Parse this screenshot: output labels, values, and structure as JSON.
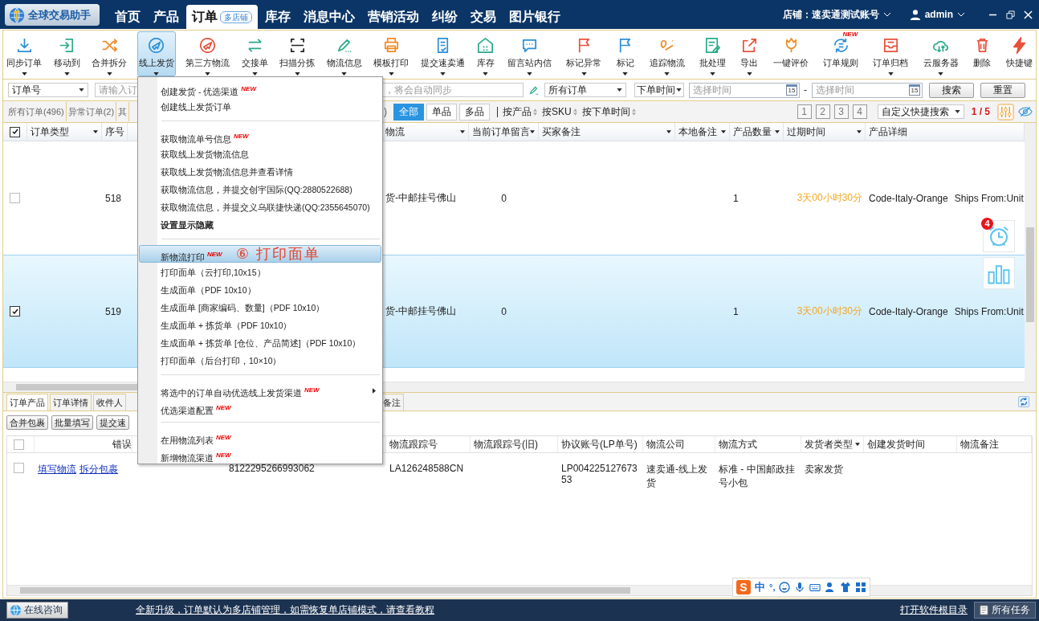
{
  "topbar": {
    "logo": "全球交易助手",
    "nav": [
      {
        "label": "首页",
        "selected": false
      },
      {
        "label": "产品",
        "selected": false
      },
      {
        "label": "订单",
        "selected": true,
        "badge": "多店铺"
      },
      {
        "label": "库存",
        "selected": false
      },
      {
        "label": "消息中心",
        "selected": false
      },
      {
        "label": "营销活动",
        "selected": false
      },
      {
        "label": "纠纷",
        "selected": false
      },
      {
        "label": "交易",
        "selected": false
      },
      {
        "label": "图片银行",
        "selected": false
      }
    ],
    "store": "店铺：速卖通测试账号",
    "user": "admin"
  },
  "toolbar": {
    "left": [
      {
        "label": "同步订单",
        "dropdown": true,
        "selected": false
      },
      {
        "label": "移动到",
        "dropdown": true,
        "selected": false
      },
      {
        "label": "合并拆分",
        "dropdown": true,
        "selected": false
      },
      {
        "label": "线上发货",
        "dropdown": true,
        "selected": true
      },
      {
        "label": "第三方物流",
        "dropdown": true,
        "selected": false
      },
      {
        "label": "交接单",
        "dropdown": true,
        "selected": false
      },
      {
        "label": "扫描分拣",
        "dropdown": true,
        "selected": false
      },
      {
        "label": "物流信息",
        "dropdown": true,
        "selected": false
      },
      {
        "label": "模板打印",
        "dropdown": true,
        "selected": false
      },
      {
        "label": "提交速卖通",
        "dropdown": true,
        "selected": false
      },
      {
        "label": "库存",
        "dropdown": true,
        "selected": false
      }
    ],
    "right": [
      {
        "label": "留言站内信",
        "dropdown": true,
        "selected": false
      },
      {
        "label": "标记异常",
        "dropdown": true,
        "selected": false
      },
      {
        "label": "标记",
        "dropdown": true,
        "selected": false
      },
      {
        "label": "追踪物流",
        "dropdown": true,
        "selected": false
      },
      {
        "label": "批处理",
        "dropdown": true,
        "selected": false
      },
      {
        "label": "导出",
        "dropdown": true,
        "selected": false
      },
      {
        "label": "一键评价",
        "dropdown": false,
        "selected": false
      },
      {
        "label": "订单规则",
        "dropdown": false,
        "selected": false,
        "badge": "NEW"
      },
      {
        "label": "订单归档",
        "dropdown": true,
        "selected": false
      },
      {
        "label": "云服务器",
        "dropdown": true,
        "selected": false
      },
      {
        "label": "删除",
        "dropdown": false,
        "selected": false
      },
      {
        "label": "快捷键",
        "dropdown": false,
        "selected": false
      }
    ]
  },
  "filters": {
    "field_select": "订单号",
    "search_placeholder_start": "请输入订",
    "search_placeholder_end": "，将会自动同步",
    "status_select": "所有订单",
    "time_select": "下单时间",
    "date_from": "选择时间",
    "date_to": "选择时间",
    "calendar_from_day": "15",
    "calendar_to_day": "15",
    "range_separator": "-",
    "buttons": [
      "搜索",
      "重置"
    ]
  },
  "status_tabs": {
    "tabs": [
      {
        "label": "所有订单(496)",
        "selected": false
      },
      {
        "label": "异常订单(2)",
        "selected": false
      },
      {
        "label": "其",
        "selected": false
      }
    ],
    "hidden_tab_tail": ")",
    "chips": [
      {
        "label": "全部",
        "selected": true
      },
      {
        "label": "单品",
        "selected": false
      },
      {
        "label": "多品",
        "selected": false
      }
    ],
    "sorts": [
      "按产品",
      "按SKU",
      "按下单时间"
    ],
    "pages": [
      "1",
      "2",
      "3",
      "4"
    ],
    "quick_search": "自定义快捷搜索",
    "page_info": "1 / 5"
  },
  "table": {
    "all_checked": true,
    "columns_left": [
      {
        "label": "订单类型",
        "dropdown": true
      },
      {
        "label": "序号",
        "dropdown": false
      }
    ],
    "columns_right": [
      {
        "label": "物流",
        "dropdown": true
      },
      {
        "label": "当前订单留言",
        "dropdown": true
      },
      {
        "label": "买家备注",
        "dropdown": true
      },
      {
        "label": "本地备注",
        "dropdown": true
      },
      {
        "label": "产品数量",
        "dropdown": true
      },
      {
        "label": "过期时间",
        "dropdown": true
      },
      {
        "label": "产品详细",
        "dropdown": false
      }
    ],
    "rows": [
      {
        "checked": false,
        "selected": false,
        "no": "518",
        "logistics": "货-中邮挂号佛山",
        "message": "0",
        "quantity": "1",
        "expires": "3天00小时30分",
        "product": "Code-Italy-Orange",
        "ships_from": "Ships From:Unit"
      },
      {
        "checked": true,
        "selected": true,
        "no": "519",
        "logistics": "货-中邮挂号佛山",
        "message": "0",
        "quantity": "1",
        "expires": "3天00小时30分",
        "product": "Code-Italy-Orange",
        "ships_from": "Ships From:Unit"
      }
    ]
  },
  "reminder": {
    "badge": "4"
  },
  "detail_panel": {
    "tabs": [
      {
        "label": "订单产品",
        "selected": true
      },
      {
        "label": "订单详情",
        "selected": false
      },
      {
        "label": "收件人",
        "selected": false
      }
    ],
    "hidden_tab_tail": "备注",
    "buttons": [
      "合并包裹",
      "批量填写",
      "提交速"
    ],
    "column_left": "错误",
    "all_checked": false,
    "columns": [
      {
        "label": "物流跟踪号",
        "dropdown": false
      },
      {
        "label": "物流跟踪号(旧)",
        "dropdown": false
      },
      {
        "label": "协议账号(LP单号)",
        "dropdown": false
      },
      {
        "label": "物流公司",
        "dropdown": false
      },
      {
        "label": "物流方式",
        "dropdown": false
      },
      {
        "label": "发货者类型",
        "dropdown": true
      },
      {
        "label": "创建发货时间",
        "dropdown": false
      },
      {
        "label": "物流备注",
        "dropdown": false
      }
    ],
    "rows": [
      {
        "checked": false,
        "links": [
          "填写物流",
          "拆分包裹"
        ],
        "number": "8122295266993062",
        "tracking": "LA126248588CN",
        "lp_number": "LP00422512767353",
        "company": "速卖通-线上发货",
        "method": "标准 - 中国邮政挂号小包",
        "shipper": "卖家发货"
      }
    ]
  },
  "menu": {
    "annotation": "⑥ 打印面单",
    "groups": [
      [
        {
          "label": "创建发货 - 优选渠道",
          "badge": "NEW",
          "bold": false,
          "selected": false,
          "submenu": false
        },
        {
          "label": "创建线上发货订单",
          "bold": false,
          "selected": false,
          "submenu": false
        }
      ],
      [
        {
          "label": "获取物流单号信息",
          "badge": "NEW",
          "bold": false,
          "selected": false,
          "submenu": false
        },
        {
          "label": "获取线上发货物流信息",
          "bold": false,
          "selected": false,
          "submenu": false
        },
        {
          "label": "获取线上发货物流信息并查看详情",
          "bold": false,
          "selected": false,
          "submenu": false
        },
        {
          "label": "获取物流信息，并提交创宇国际(QQ:2880522688)",
          "bold": false,
          "selected": false,
          "submenu": false
        },
        {
          "label": "获取物流信息，并提交义乌联捷快递(QQ:2355645070)",
          "bold": false,
          "selected": false,
          "submenu": false
        },
        {
          "label": "设置显示隐藏",
          "bold": true,
          "selected": false,
          "submenu": false
        }
      ],
      [
        {
          "label": "新物流打印",
          "badge": "NEW",
          "bold": false,
          "selected": true,
          "submenu": false
        },
        {
          "label": "打印面单（云打印,10x15）",
          "bold": false,
          "selected": false,
          "submenu": false
        },
        {
          "label": "生成面单（PDF 10x10）",
          "bold": false,
          "selected": false,
          "submenu": false
        },
        {
          "label": "生成面单  [商家编码、数量]（PDF 10x10）",
          "bold": false,
          "selected": false,
          "submenu": false
        },
        {
          "label": "生成面单 + 拣货单（PDF 10x10）",
          "bold": false,
          "selected": false,
          "submenu": false
        },
        {
          "label": "生成面单 + 拣货单 [仓位、产品简述]（PDF 10x10）",
          "bold": false,
          "selected": false,
          "submenu": false
        },
        {
          "label": "打印面单（后台打印，10×10）",
          "bold": false,
          "selected": false,
          "submenu": false
        }
      ],
      [
        {
          "label": "将选中的订单自动优选线上发货渠道",
          "badge": "NEW",
          "bold": false,
          "selected": false,
          "submenu": true
        },
        {
          "label": "优选渠道配置",
          "badge": "NEW",
          "bold": false,
          "selected": false,
          "submenu": false
        }
      ],
      [
        {
          "label": "在用物流列表",
          "badge": "NEW",
          "bold": false,
          "selected": false,
          "submenu": false
        },
        {
          "label": "新增物流渠道",
          "badge": "NEW",
          "bold": false,
          "selected": false,
          "submenu": false
        }
      ]
    ]
  },
  "ime": {
    "logo": "S",
    "mode": "中",
    "punctuation": "°,"
  },
  "status_bar": {
    "consult": "在线咨询",
    "notice": "全新升级，订单默认为多店铺管理，如需恢复单店铺模式，请查看教程",
    "open_folder": "打开软件根目录",
    "tasks": "所有任务"
  }
}
